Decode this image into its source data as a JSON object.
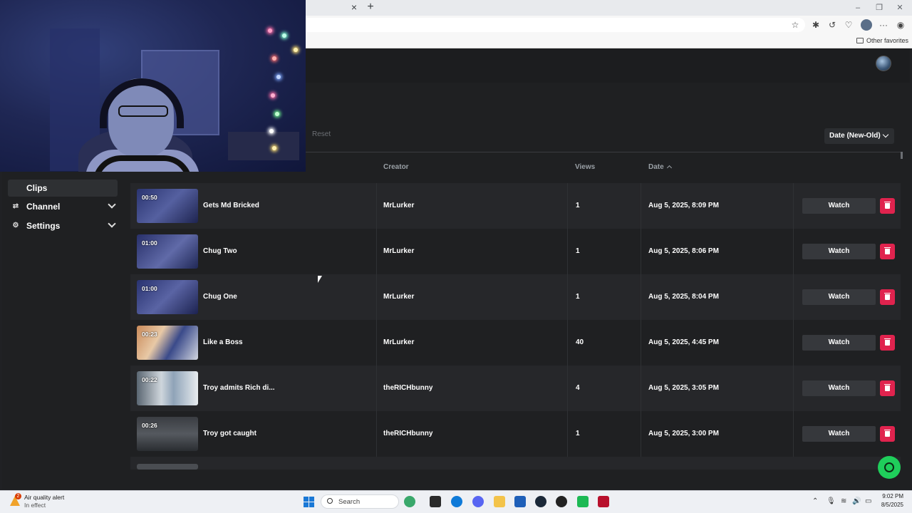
{
  "browser": {
    "favorites_folder": "Other favorites"
  },
  "toolbar": {
    "reset_label": "Reset",
    "sort_label": "Date (New-Old)"
  },
  "sidebar": {
    "items": [
      {
        "label": "Clips",
        "active": true
      },
      {
        "label": "Channel",
        "expandable": true
      },
      {
        "label": "Settings",
        "expandable": true
      }
    ]
  },
  "table": {
    "headers": {
      "creator": "Creator",
      "views": "Views",
      "date": "Date"
    },
    "watch_label": "Watch",
    "rows": [
      {
        "duration": "00:50",
        "title": "Gets Md Bricked",
        "creator": "MrLurker",
        "views": "1",
        "date": "Aug 5, 2025, 8:09 PM"
      },
      {
        "duration": "01:00",
        "title": "Chug Two",
        "creator": "MrLurker",
        "views": "1",
        "date": "Aug 5, 2025, 8:06 PM"
      },
      {
        "duration": "01:00",
        "title": "Chug One",
        "creator": "MrLurker",
        "views": "1",
        "date": "Aug 5, 2025, 8:04 PM"
      },
      {
        "duration": "00:23",
        "title": "Like a Boss",
        "creator": "MrLurker",
        "views": "40",
        "date": "Aug 5, 2025, 4:45 PM"
      },
      {
        "duration": "00:22",
        "title": "Troy admits Rich di...",
        "creator": "theRICHbunny",
        "views": "4",
        "date": "Aug 5, 2025, 3:05 PM"
      },
      {
        "duration": "00:26",
        "title": "Troy got caught",
        "creator": "theRICHbunny",
        "views": "1",
        "date": "Aug 5, 2025, 3:00 PM"
      }
    ]
  },
  "taskbar": {
    "weather_badge": "2",
    "weather_title": "Air quality alert",
    "weather_sub": "In effect",
    "search_placeholder": "Search",
    "time": "9:02 PM",
    "date": "8/5/2025"
  },
  "colors": {
    "delete": "#e0234e",
    "support": "#1fce5b",
    "app_bg": "#1f2022"
  }
}
